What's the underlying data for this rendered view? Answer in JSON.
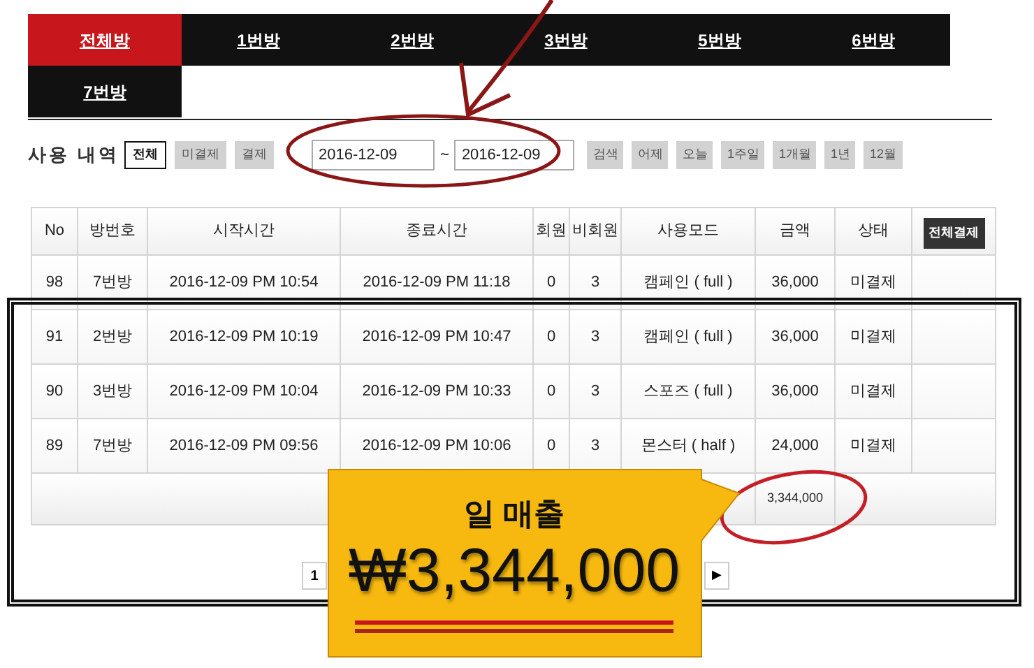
{
  "tabs": [
    {
      "label": "전체방",
      "selected": true
    },
    {
      "label": "1번방",
      "selected": false
    },
    {
      "label": "2번방",
      "selected": false
    },
    {
      "label": "3번방",
      "selected": false
    },
    {
      "label": "5번방",
      "selected": false
    },
    {
      "label": "6번방",
      "selected": false
    },
    {
      "label": "7번방",
      "selected": false
    }
  ],
  "history": {
    "title": "사용 내역",
    "filters": [
      {
        "label": "전체",
        "selected": true
      },
      {
        "label": "미결제",
        "selected": false
      },
      {
        "label": "결제",
        "selected": false
      }
    ],
    "date_from": "2016-12-09",
    "separator": "~",
    "date_to": "2016-12-09",
    "quick_buttons": [
      "검색",
      "어제",
      "오늘",
      "1주일",
      "1개월",
      "1년",
      "12월"
    ]
  },
  "table": {
    "columns": [
      "No",
      "방번호",
      "시작시간",
      "종료시간",
      "회원",
      "비회원",
      "사용모드",
      "금액",
      "상태"
    ],
    "pay_all_button": "전체결제",
    "rows": [
      [
        "98",
        "7번방",
        "2016-12-09 PM 10:54",
        "2016-12-09 PM 11:18",
        "0",
        "3",
        "캠페인 ( full )",
        "36,000",
        "미결제"
      ],
      [
        "91",
        "2번방",
        "2016-12-09 PM 10:19",
        "2016-12-09 PM 10:47",
        "0",
        "3",
        "캠페인 ( full )",
        "36,000",
        "미결제"
      ],
      [
        "90",
        "3번방",
        "2016-12-09 PM 10:04",
        "2016-12-09 PM 10:33",
        "0",
        "3",
        "스포즈 ( full )",
        "36,000",
        "미결제"
      ],
      [
        "89",
        "7번방",
        "2016-12-09 PM 09:56",
        "2016-12-09 PM 10:06",
        "0",
        "3",
        "몬스터 ( half )",
        "24,000",
        "미결제"
      ]
    ],
    "total": "3,344,000"
  },
  "pagination": {
    "first_page": "1",
    "next": "▶"
  },
  "callout": {
    "title": "일 매출",
    "amount": "₩3,344,000"
  }
}
